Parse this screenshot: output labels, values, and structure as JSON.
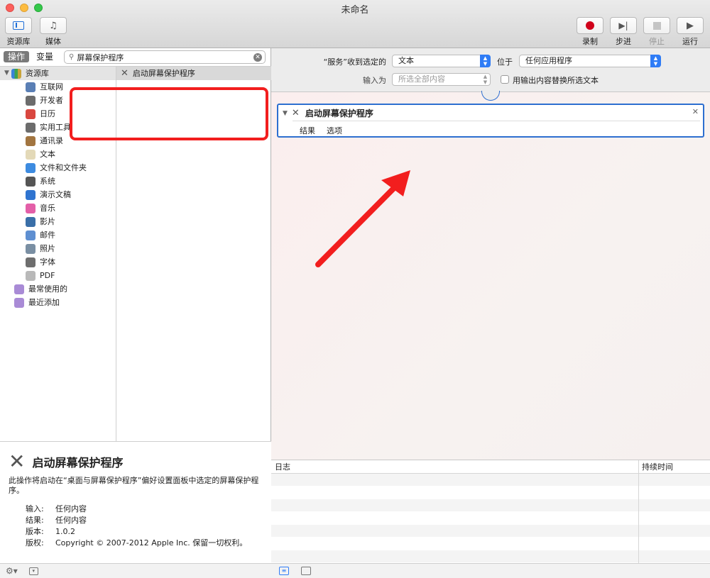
{
  "window": {
    "title": "未命名"
  },
  "toolbar": {
    "library": "资源库",
    "media": "媒体",
    "record": "录制",
    "step": "步进",
    "stop": "停止",
    "run": "运行"
  },
  "left": {
    "tab_actions": "操作",
    "tab_variables": "变量",
    "search_value": "屏幕保护程序",
    "library_header": "资源库",
    "library_items": [
      {
        "label": "互联网",
        "icon": "globe-icon",
        "color": "#5a7fb5"
      },
      {
        "label": "开发者",
        "icon": "tools-icon",
        "color": "#6c6c6c"
      },
      {
        "label": "日历",
        "icon": "calendar-icon",
        "color": "#d9473f"
      },
      {
        "label": "实用工具",
        "icon": "tools-icon",
        "color": "#6c6c6c"
      },
      {
        "label": "通讯录",
        "icon": "contacts-icon",
        "color": "#a27540"
      },
      {
        "label": "文本",
        "icon": "text-icon",
        "color": "#e3d9b8"
      },
      {
        "label": "文件和文件夹",
        "icon": "finder-icon",
        "color": "#3d8be0"
      },
      {
        "label": "系统",
        "icon": "system-icon",
        "color": "#555555"
      },
      {
        "label": "演示文稿",
        "icon": "keynote-icon",
        "color": "#2f74d0"
      },
      {
        "label": "音乐",
        "icon": "music-icon",
        "color": "#e35fa8"
      },
      {
        "label": "影片",
        "icon": "movie-icon",
        "color": "#3a6fa8"
      },
      {
        "label": "邮件",
        "icon": "mail-icon",
        "color": "#5e8fd1"
      },
      {
        "label": "照片",
        "icon": "photo-icon",
        "color": "#7a8fa3"
      },
      {
        "label": "字体",
        "icon": "font-icon",
        "color": "#6e6e6e"
      },
      {
        "label": "PDF",
        "icon": "pdf-icon",
        "color": "#b9b9b9"
      }
    ],
    "smart_folders": [
      {
        "label": "最常使用的",
        "icon": "smart-folder-icon",
        "color": "#a98bd6"
      },
      {
        "label": "最近添加",
        "icon": "smart-folder-icon",
        "color": "#a98bd6"
      }
    ],
    "action_result": "启动屏幕保护程序"
  },
  "description": {
    "title": "启动屏幕保护程序",
    "text": "此操作将启动在“桌面与屏幕保护程序”偏好设置面板中选定的屏幕保护程序。",
    "input_label": "输入:",
    "input_value": "任何内容",
    "result_label": "结果:",
    "result_value": "任何内容",
    "version_label": "版本:",
    "version_value": "1.0.2",
    "copyright_label": "版权:",
    "copyright_value": "Copyright © 2007-2012 Apple Inc. 保留一切权利。"
  },
  "service": {
    "receives_label": "“服务”收到选定的",
    "receives_value": "文本",
    "in_label": "位于",
    "in_value": "任何应用程序",
    "input_is_label": "输入为",
    "input_is_value": "所选全部内容",
    "replace_label": "用输出内容替换所选文本"
  },
  "action_card": {
    "title": "启动屏幕保护程序",
    "tab_results": "结果",
    "tab_options": "选项"
  },
  "log": {
    "col_log": "日志",
    "col_duration": "持续时间"
  },
  "colors": {
    "accent": "#2f7cf6",
    "annotation_red": "#f21e1e",
    "record_red": "#d0021b"
  }
}
